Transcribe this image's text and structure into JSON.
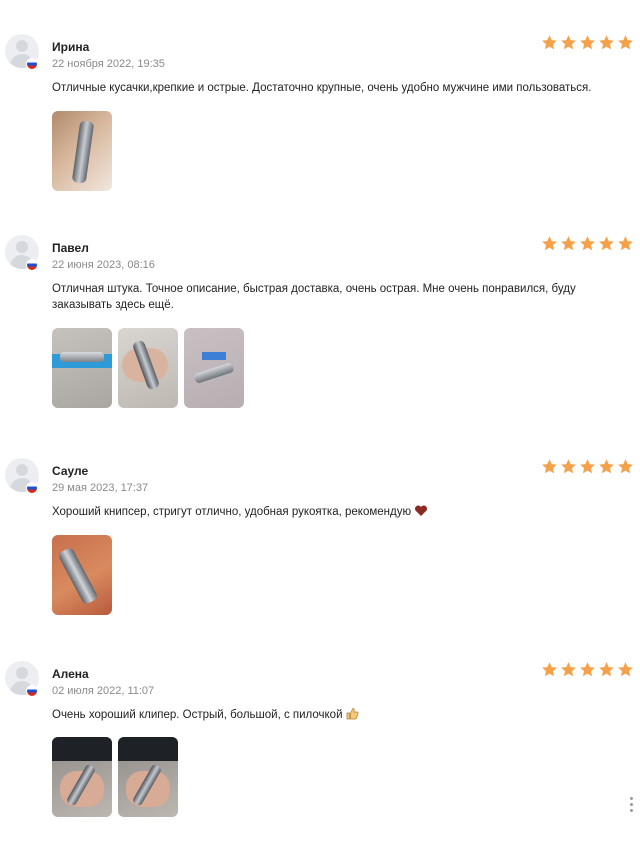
{
  "colors": {
    "star": "#f5a14a",
    "date": "#8a8a8a",
    "text": "#222222"
  },
  "reviews": [
    {
      "name": "Ирина",
      "date": "22 ноября 2022, 19:35",
      "rating": 5,
      "text": "Отличные кусачки,крепкие и острые. Достаточно крупные, очень удобно мужчине ими пользоваться.",
      "photos": [
        "review-photo-nail-clipper-in-hand"
      ]
    },
    {
      "name": "Павел",
      "date": "22 июня 2023, 08:16",
      "rating": 5,
      "text": "Отличная штука. Точное описание, быстрая доставка, очень острая. Мне очень понравился, буду заказывать здесь ещё.",
      "photos": [
        "review-photo-clipper-on-package",
        "review-photo-clipper-in-hand",
        "review-photo-clipper-with-box"
      ]
    },
    {
      "name": "Сауле",
      "date": "29 мая 2023, 17:37",
      "rating": 5,
      "text": "Хороший книпсер, стригут отлично, удобная рукоятка, рекомендую",
      "emoji": "heart-icon",
      "photos": [
        "review-photo-clipper-on-orange"
      ]
    },
    {
      "name": "Алена",
      "date": "02 июля 2022, 11:07",
      "rating": 5,
      "text": "Очень хороший клипер. Острый, большой, с пилочкой",
      "emoji": "thumbs-up-icon",
      "photos": [
        "review-photo-clipper-in-hand-1",
        "review-photo-clipper-in-hand-2"
      ]
    }
  ]
}
